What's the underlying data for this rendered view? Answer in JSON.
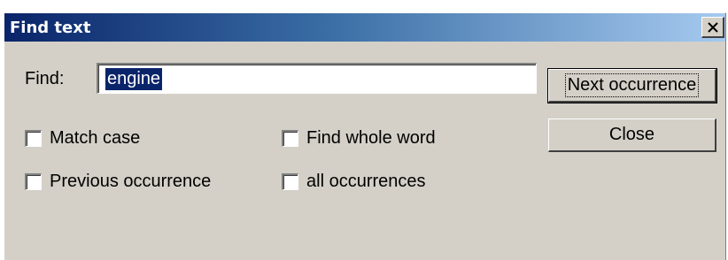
{
  "window": {
    "title": "Find text",
    "close_glyph": "×"
  },
  "find": {
    "label": "Find:",
    "value": "engine"
  },
  "buttons": {
    "next_label": "Next occurrence",
    "close_label": "Close"
  },
  "options": [
    {
      "label": "Match case",
      "checked": false
    },
    {
      "label": "Find whole word",
      "checked": false
    },
    {
      "label": "Previous occurrence",
      "checked": false
    },
    {
      "label": "all occurrences",
      "checked": false
    }
  ],
  "colors": {
    "title_start": "#0a246a",
    "title_end": "#a6caf0",
    "face": "#d4d0c8",
    "selection": "#0a246a"
  },
  "icons": {
    "close": "close-icon"
  }
}
